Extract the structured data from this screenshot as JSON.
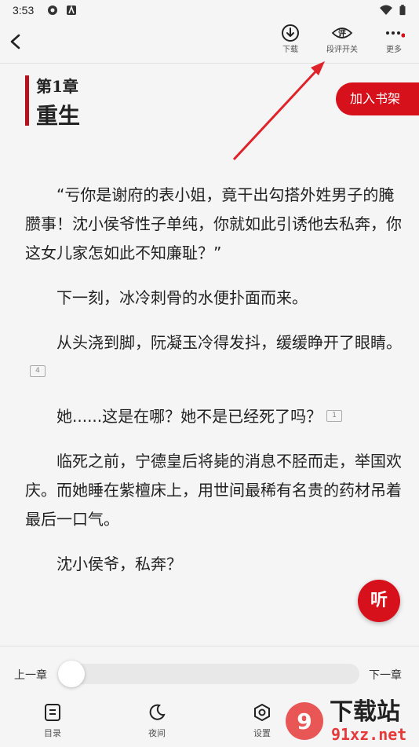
{
  "status": {
    "time": "3:53"
  },
  "toolbar": {
    "download": "下载",
    "comment_toggle": "段评开关",
    "comment_icon_char": "评",
    "more": "更多"
  },
  "chapter": {
    "number": "第1章",
    "title": "重生"
  },
  "add_shelf": "加入书架",
  "paragraphs": [
    "“亏你是谢府的表小姐，竟干出勾搭外姓男子的腌臜事！沈小侯爷性子单纯，你就如此引诱他去私奔，你这女儿家怎如此不知廉耻？”",
    "下一刻，冰冷刺骨的水便扑面而来。",
    "从头浇到脚，阮凝玉冷得发抖，缓缓睁开了眼睛。",
    "她......这是在哪？她不是已经死了吗？",
    "临死之前，宁德皇后将毙的消息不胫而走，举国欢庆。而她睡在紫檀床上，用世间最稀有名贵的药材吊着最后一口气。",
    "沈小侯爷，私奔？"
  ],
  "comment_counts": {
    "p3": "4",
    "p4": "1"
  },
  "listen": "听",
  "reader": {
    "prev": "上一章",
    "next": "下一章",
    "progress": 0.0
  },
  "nav": {
    "toc": "目录",
    "night": "夜间",
    "settings": "设置"
  },
  "watermark": {
    "main": "下载站",
    "site": "91xz.net"
  },
  "colors": {
    "accent": "#d7111b",
    "chapter_bar": "#b8101c"
  }
}
